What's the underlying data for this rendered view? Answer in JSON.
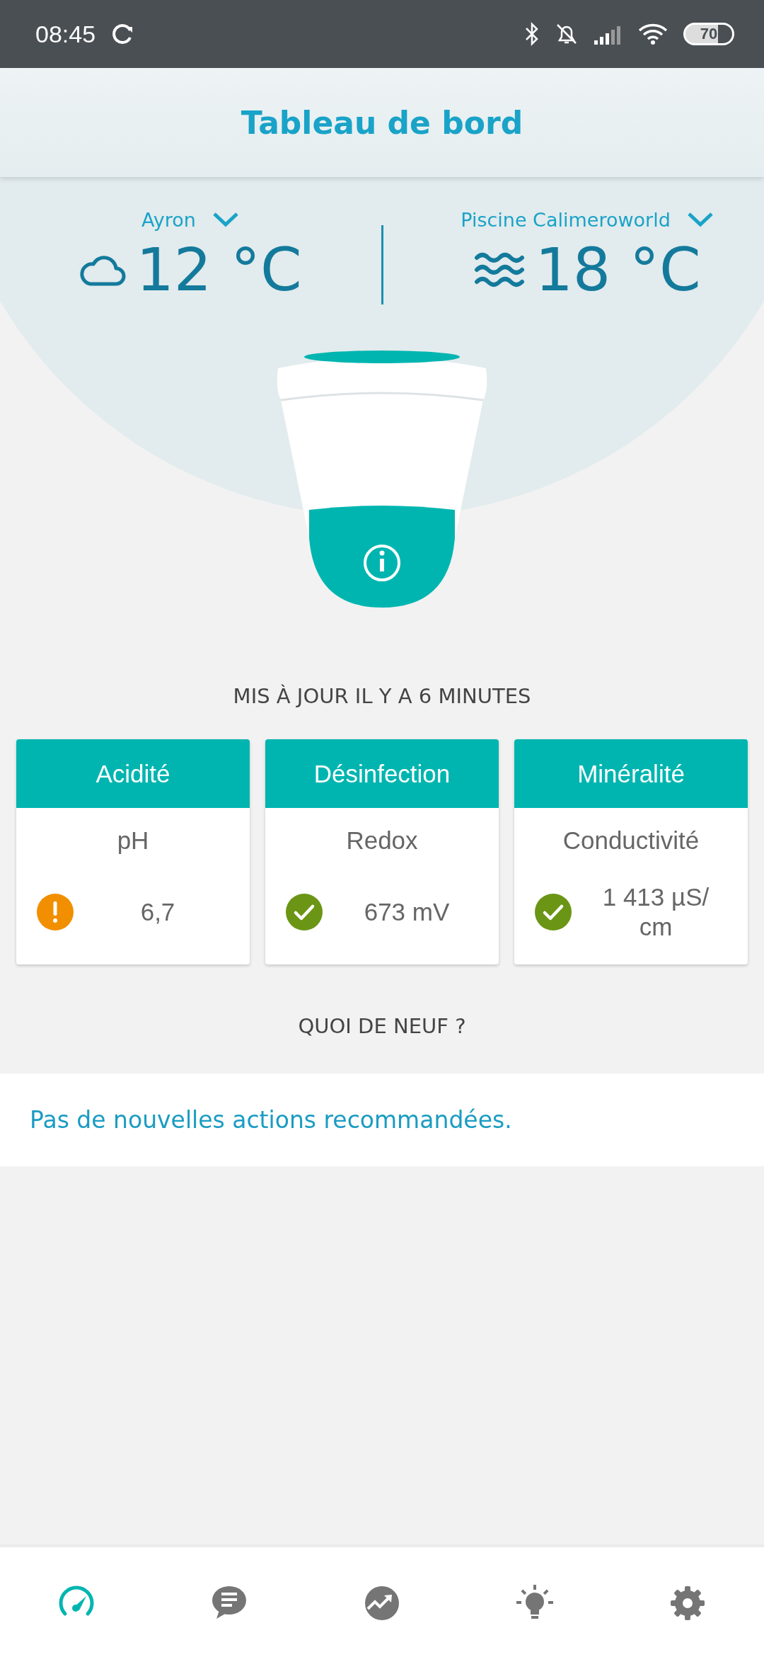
{
  "status_bar": {
    "time": "08:45",
    "battery": "70"
  },
  "header": {
    "title": "Tableau de bord"
  },
  "weather": [
    {
      "kind": "air",
      "location": "Ayron",
      "temperature": "12 °C"
    },
    {
      "kind": "water",
      "location": "Piscine Calimeroworld",
      "temperature": "18 °C"
    }
  ],
  "updated": "MIS À JOUR IL Y A 6 MINUTES",
  "cards": [
    {
      "title": "Acidité",
      "measure": "pH",
      "value": "6,7",
      "kind": "warning"
    },
    {
      "title": "Désinfection",
      "measure": "Redox",
      "value": "673 mV",
      "kind": "ok"
    },
    {
      "title": "Minéralité",
      "measure": "Conductivité",
      "value": "1 413 µS/ cm",
      "kind": "ok"
    }
  ],
  "news": {
    "heading": "QUOI DE NEUF ?",
    "message": "Pas de nouvelles actions recommandées."
  },
  "nav": [
    {
      "kind": "dashboard",
      "selected": true
    },
    {
      "kind": "messages",
      "selected": false
    },
    {
      "kind": "charts",
      "selected": false
    },
    {
      "kind": "tips",
      "selected": false
    },
    {
      "kind": "settings",
      "selected": false
    }
  ]
}
